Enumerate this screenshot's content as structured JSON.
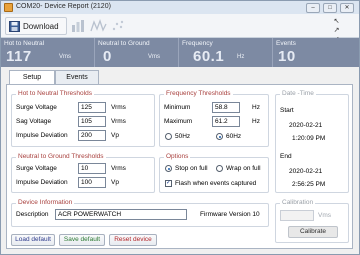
{
  "window": {
    "title": "COM20- Device Report (2120)",
    "minimize_glyph": "–",
    "maximize_glyph": "□",
    "close_glyph": "✕"
  },
  "toolbar": {
    "download_label": "Download",
    "expand_glyph": "↖ ↗ ↙ ↘"
  },
  "meters": [
    {
      "label": "Hot to Neutral",
      "value": "117",
      "unit": "Vms"
    },
    {
      "label": "Neutral to Ground",
      "value": "0",
      "unit": "Vms"
    },
    {
      "label": "Frequency",
      "value": "60.1",
      "unit": "Hz"
    },
    {
      "label": "Events",
      "value": "10",
      "unit": ""
    }
  ],
  "tabs": [
    {
      "label": "Setup",
      "active": true
    },
    {
      "label": "Events",
      "active": false
    }
  ],
  "hot_neutral": {
    "title": "Hot to Neutral Thresholds",
    "rows": [
      {
        "label": "Surge Voltage",
        "value": "125",
        "unit": "Vrms"
      },
      {
        "label": "Sag Voltage",
        "value": "105",
        "unit": "Vrms"
      },
      {
        "label": "Impulse Deviation",
        "value": "200",
        "unit": "Vp"
      }
    ]
  },
  "neutral_ground": {
    "title": "Neutral to Ground Thresholds",
    "rows": [
      {
        "label": "Surge Voltage",
        "value": "10",
        "unit": "Vrms"
      },
      {
        "label": "Impulse Deviation",
        "value": "100",
        "unit": "Vp"
      }
    ]
  },
  "frequency": {
    "title": "Frequency Thresholds",
    "rows": [
      {
        "label": "Minimum",
        "value": "58.8",
        "unit": "Hz"
      },
      {
        "label": "Maximum",
        "value": "61.2",
        "unit": "Hz"
      }
    ],
    "option_50": "50Hz",
    "option_60": "60Hz",
    "selected": "60Hz"
  },
  "options": {
    "title": "Options",
    "stop_on_full": "Stop on full",
    "wrap_on_full": "Wrap on full",
    "selected": "Stop on full",
    "flash_label": "Flash when events captured",
    "flash_checked": true
  },
  "date_time": {
    "title": "Date -Time",
    "start_label": "Start",
    "start_date": "2020-02-21",
    "start_time": "1:20:09 PM",
    "end_label": "End",
    "end_date": "2020-02-21",
    "end_time": "2:56:25 PM"
  },
  "device_info": {
    "title": "Device Information",
    "description_label": "Description",
    "description_value": "ACR POWERWATCH",
    "firmware_label": "Firmware Version 10"
  },
  "calibration": {
    "title": "Calibration",
    "value": "",
    "unit": "Vms",
    "button_label": "Calibrate"
  },
  "buttons": {
    "load_default": "Load default",
    "save_default": "Save default",
    "reset_device": "Reset device"
  }
}
